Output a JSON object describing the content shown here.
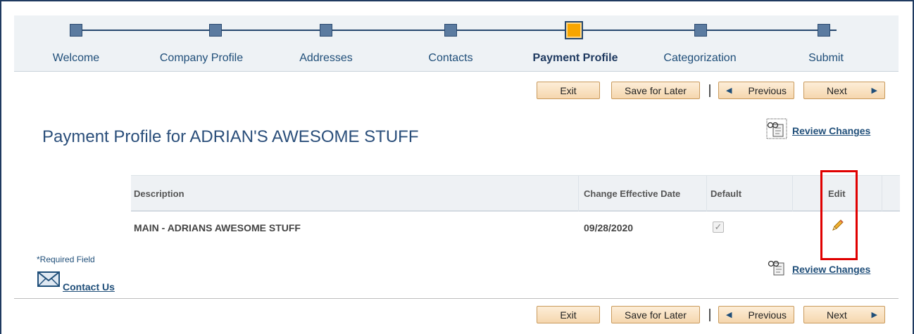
{
  "train": {
    "steps": [
      {
        "label": "Welcome",
        "active": false
      },
      {
        "label": "Company Profile",
        "active": false
      },
      {
        "label": "Addresses",
        "active": false
      },
      {
        "label": "Contacts",
        "active": false
      },
      {
        "label": "Payment Profile",
        "active": true
      },
      {
        "label": "Categorization",
        "active": false
      },
      {
        "label": "Submit",
        "active": false
      }
    ]
  },
  "toolbar": {
    "exit_label": "Exit",
    "save_label": "Save for Later",
    "previous_label": "Previous",
    "next_label": "Next"
  },
  "page": {
    "title": "Payment Profile for ADRIAN'S AWESOME STUFF",
    "review_changes_label": "Review Changes"
  },
  "grid": {
    "headers": {
      "description": "Description",
      "effective_date": "Change Effective Date",
      "default": "Default",
      "edit": "Edit"
    },
    "rows": [
      {
        "description": "MAIN - ADRIANS AWESOME STUFF",
        "effective_date": "09/28/2020",
        "default": true
      }
    ]
  },
  "footer": {
    "required_label": "*Required Field",
    "contact_label": "Contact Us"
  },
  "colors": {
    "accent": "#1f4e79",
    "active_step": "#f7a500",
    "button_bg": "#f5d6ae",
    "highlight": "#e00000"
  },
  "icons": [
    "review-changes-icon",
    "pencil-edit-icon",
    "mail-icon",
    "chevron-left-icon",
    "chevron-right-icon"
  ]
}
